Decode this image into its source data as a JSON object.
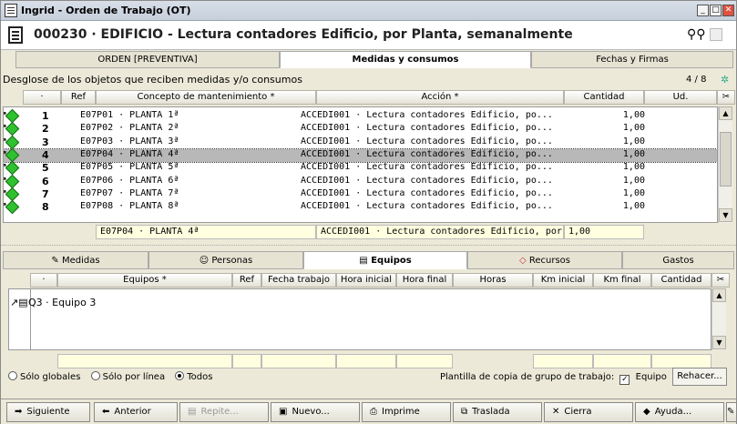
{
  "window": {
    "title": "Ingrid - Orden de Trabajo (OT)"
  },
  "document": {
    "title": "000230 · EDIFICIO - Lectura contadores Edificio, por Planta, semanalmente"
  },
  "top_tabs": [
    {
      "label": "ORDEN [PREVENTIVA]"
    },
    {
      "label": "Medidas y consumos"
    },
    {
      "label": "Fechas y Firmas"
    }
  ],
  "section": {
    "label": "Desglose de los objetos que reciben medidas y/o consumos",
    "count": "4 / 8"
  },
  "grid1": {
    "headers": {
      "dot": "·",
      "ref": "Ref",
      "concepto": "Concepto de mantenimiento *",
      "accion": "Acción *",
      "cantidad": "Cantidad",
      "ud": "Ud."
    },
    "rows": [
      {
        "ref": "1",
        "concepto": "E07P01 · PLANTA 1ª",
        "accion": "ACCEDI001 · Lectura contadores Edificio, po...",
        "cantidad": "1,00"
      },
      {
        "ref": "2",
        "concepto": "E07P02 · PLANTA 2ª",
        "accion": "ACCEDI001 · Lectura contadores Edificio, po...",
        "cantidad": "1,00"
      },
      {
        "ref": "3",
        "concepto": "E07P03 · PLANTA 3ª",
        "accion": "ACCEDI001 · Lectura contadores Edificio, po...",
        "cantidad": "1,00"
      },
      {
        "ref": "4",
        "concepto": "E07P04 · PLANTA 4ª",
        "accion": "ACCEDI001 · Lectura contadores Edificio, po...",
        "cantidad": "1,00"
      },
      {
        "ref": "5",
        "concepto": "E07P05 · PLANTA 5ª",
        "accion": "ACCEDI001 · Lectura contadores Edificio, po...",
        "cantidad": "1,00"
      },
      {
        "ref": "6",
        "concepto": "E07P06 · PLANTA 6ª",
        "accion": "ACCEDI001 · Lectura contadores Edificio, po...",
        "cantidad": "1,00"
      },
      {
        "ref": "7",
        "concepto": "E07P07 · PLANTA 7ª",
        "accion": "ACCEDI001 · Lectura contadores Edificio, po...",
        "cantidad": "1,00"
      },
      {
        "ref": "8",
        "concepto": "E07P08 · PLANTA 8ª",
        "accion": "ACCEDI001 · Lectura contadores Edificio, po...",
        "cantidad": "1,00"
      }
    ],
    "edit": {
      "concepto": "E07P04 · PLANTA 4ª",
      "accion": "ACCEDI001 · Lectura contadores Edificio, por",
      "cantidad": "1,00"
    }
  },
  "bottom_tabs": [
    {
      "label": "Medidas"
    },
    {
      "label": "Personas"
    },
    {
      "label": "Equipos"
    },
    {
      "label": "Recursos"
    },
    {
      "label": "Gastos"
    }
  ],
  "grid2": {
    "headers": {
      "dot": "·",
      "equipos": "Equipos *",
      "ref": "Ref",
      "fecha": "Fecha trabajo",
      "hini": "Hora inicial",
      "hfin": "Hora final",
      "horas": "Horas",
      "kmini": "Km inicial",
      "kmfin": "Km final",
      "cantidad": "Cantidad"
    },
    "rows": [
      {
        "label": "Q3 · Equipo 3"
      }
    ]
  },
  "filters": {
    "solo_globales": "Sólo globales",
    "solo_linea": "Sólo por línea",
    "todos": "Todos",
    "selected": "Todos"
  },
  "plantilla": {
    "label": "Plantilla de copia de grupo de trabajo:",
    "check_label": "Equipo",
    "checked": true,
    "rehacer": "Rehacer..."
  },
  "buttons": [
    {
      "label": "Siguiente",
      "icon": "arrow-right-icon",
      "glyph": "➡"
    },
    {
      "label": "Anterior",
      "icon": "arrow-left-icon",
      "glyph": "⬅"
    },
    {
      "label": "Repite...",
      "icon": "repeat-icon",
      "glyph": "▤"
    },
    {
      "label": "Nuevo...",
      "icon": "new-document-icon",
      "glyph": "▣"
    },
    {
      "label": "Imprime",
      "icon": "printer-icon",
      "glyph": "⎙"
    },
    {
      "label": "Traslada",
      "icon": "move-icon",
      "glyph": "⧉"
    },
    {
      "label": "Cierra",
      "icon": "close-icon",
      "glyph": "✕"
    },
    {
      "label": "Ayuda...",
      "icon": "help-icon",
      "glyph": "◆"
    }
  ],
  "colors": {
    "selected_row": "#b8b8b8",
    "edit_bg": "#ffffe0",
    "row_icon": "#2ec22e"
  }
}
